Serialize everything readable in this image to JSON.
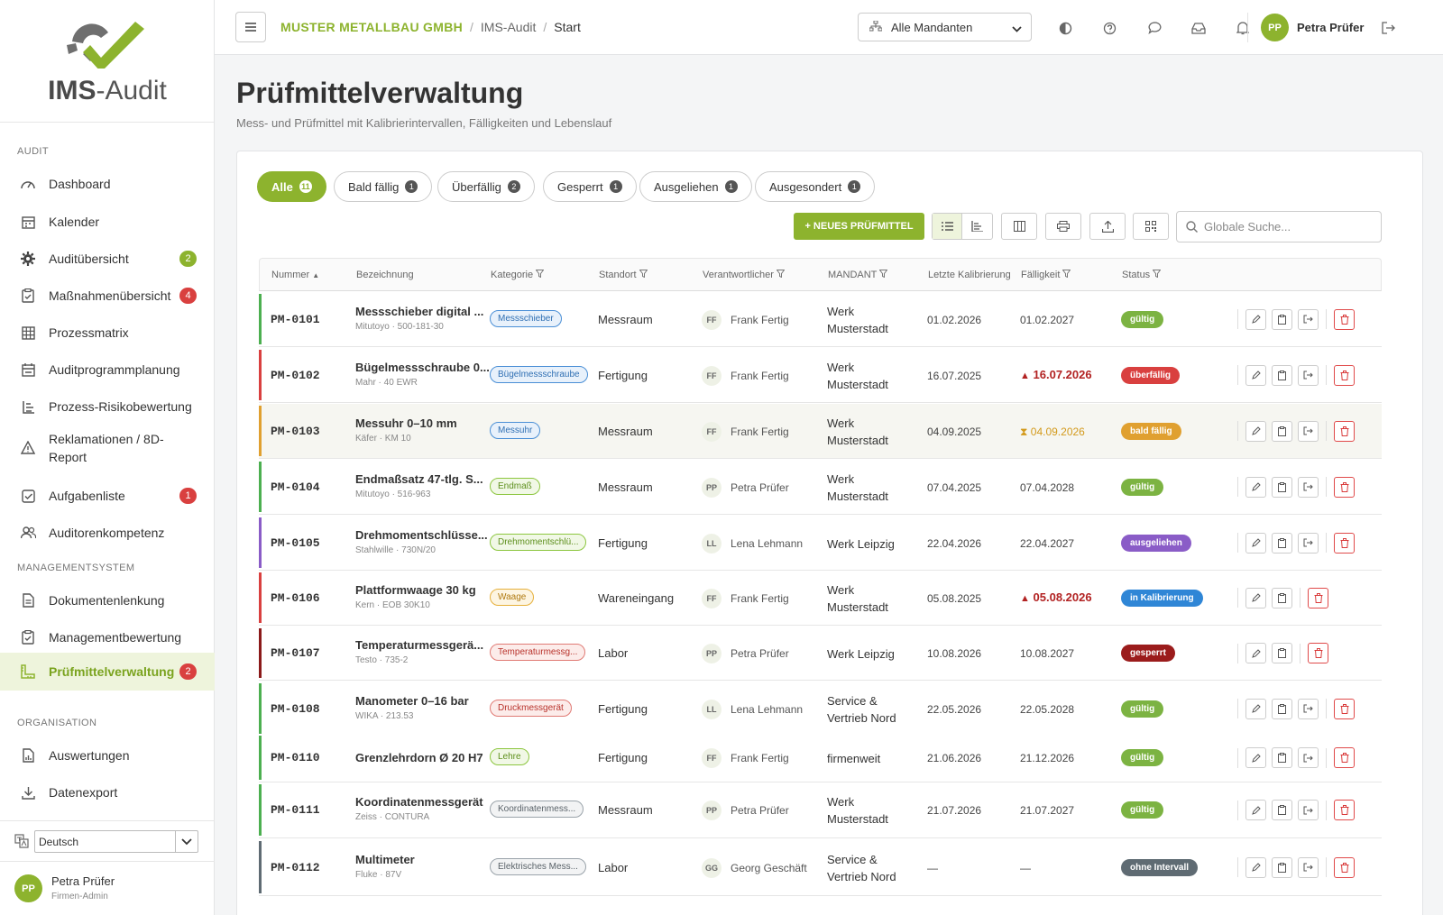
{
  "app": {
    "logo_text_bold": "IMS",
    "logo_text_rest": "-Audit"
  },
  "sidebar": {
    "sections": [
      "AUDIT",
      "MANAGEMENTSYSTEM",
      "ORGANISATION"
    ],
    "items": [
      {
        "label": "Dashboard",
        "icon": "dashboard-icon"
      },
      {
        "label": "Kalender",
        "icon": "calendar-icon"
      },
      {
        "label": "Auditübersicht",
        "icon": "gear-icon",
        "badge": "2",
        "badge_color": "#8db32e"
      },
      {
        "label": "Maßnahmenübersicht",
        "icon": "clipboard-check-icon",
        "badge": "4",
        "badge_color": "#d9403f"
      },
      {
        "label": "Prozessmatrix",
        "icon": "grid-icon"
      },
      {
        "label": "Auditprogrammplanung",
        "icon": "calendar-plan-icon"
      },
      {
        "label": "Prozess-Risikobewertung",
        "icon": "list-tree-icon"
      },
      {
        "label": "Reklamationen / 8D-",
        "label2": "Report",
        "icon": "warning-icon"
      },
      {
        "label": "Aufgabenliste",
        "icon": "checkbox-icon",
        "badge": "1",
        "badge_color": "#d9403f"
      },
      {
        "label": "Auditorenkompetenz",
        "icon": "users-icon"
      },
      {
        "label": "Dokumentenlenkung",
        "icon": "document-icon"
      },
      {
        "label": "Managementbewertung",
        "icon": "clipboard-icon"
      },
      {
        "label": "Prüfmittelverwaltung",
        "icon": "ruler-icon",
        "badge": "2",
        "badge_color": "#d9403f"
      },
      {
        "label": "Auswertungen",
        "icon": "chart-icon"
      },
      {
        "label": "Datenexport",
        "icon": "download-icon"
      }
    ],
    "language": "Deutsch",
    "user": {
      "initials": "PP",
      "name": "Petra Prüfer",
      "role": "Firmen-Admin"
    }
  },
  "topbar": {
    "breadcrumb": [
      "MUSTER METALLBAU GMBH",
      "IMS-Audit",
      "Start"
    ],
    "mandant_select": "Alle Mandanten",
    "user_initials": "PP",
    "user_name": "Petra Prüfer"
  },
  "page": {
    "title": "Prüfmittelverwaltung",
    "subtitle": "Mess- und Prüfmittel mit Kalibrierintervallen, Fälligkeiten und Lebenslauf"
  },
  "filters": [
    {
      "label": "Alle",
      "count": "11"
    },
    {
      "label": "Bald fällig",
      "count": "1"
    },
    {
      "label": "Überfällig",
      "count": "2"
    },
    {
      "label": "Gesperrt",
      "count": "1"
    },
    {
      "label": "Ausgeliehen",
      "count": "1"
    },
    {
      "label": "Ausgesondert",
      "count": "1"
    }
  ],
  "toolbar": {
    "new_button": "+ NEUES PRÜFMITTEL",
    "search_placeholder": "Globale Suche..."
  },
  "columns": [
    "Nummer",
    "Bezeichnung",
    "Kategorie",
    "Standort",
    "Verantwortlicher",
    "MANDANT",
    "Letzte Kalibrierung",
    "Fälligkeit",
    "Status"
  ],
  "colors": {
    "accent": "#8db32e",
    "danger": "#d9403f"
  },
  "rows": [
    {
      "nr": "PM-0101",
      "name": "Messschieber digital ...",
      "sub": "Mitutoyo · 500-181-30",
      "kat": "Messschieber",
      "kat_color": "blue",
      "ort": "Messraum",
      "init": "FF",
      "resp": "Frank Fertig",
      "mandant": "Werk Musterstadt",
      "last": "01.02.2026",
      "due": "01.02.2027",
      "due_type": "normal",
      "status": "gültig",
      "status_color": "#7cb342",
      "bar": "#4caf50"
    },
    {
      "nr": "PM-0102",
      "name": "Bügelmessschraube 0...",
      "sub": "Mahr · 40 EWR",
      "kat": "Bügelmessschraube",
      "kat_color": "blue",
      "ort": "Fertigung",
      "init": "FF",
      "resp": "Frank Fertig",
      "mandant": "Werk Musterstadt",
      "last": "16.07.2025",
      "due": "16.07.2026",
      "due_type": "red",
      "status": "überfällig",
      "status_color": "#d9403f",
      "bar": "#d9403f"
    },
    {
      "nr": "PM-0103",
      "name": "Messuhr 0–10 mm",
      "sub": "Käfer · KM 10",
      "kat": "Messuhr",
      "kat_color": "blue",
      "ort": "Messraum",
      "init": "FF",
      "resp": "Frank Fertig",
      "mandant": "Werk Musterstadt",
      "last": "04.09.2025",
      "due": "04.09.2026",
      "due_type": "orange",
      "status": "bald fällig",
      "status_color": "#e0a030",
      "bar": "#e0a030"
    },
    {
      "nr": "PM-0104",
      "name": "Endmaßsatz 47-tlg. S...",
      "sub": "Mitutoyo · 516-963",
      "kat": "Endmaß",
      "kat_color": "green",
      "ort": "Messraum",
      "init": "PP",
      "resp": "Petra Prüfer",
      "mandant": "Werk Musterstadt",
      "last": "07.04.2025",
      "due": "07.04.2028",
      "due_type": "normal",
      "status": "gültig",
      "status_color": "#7cb342",
      "bar": "#4caf50"
    },
    {
      "nr": "PM-0105",
      "name": "Drehmomentschlüsse...",
      "sub": "Stahlwille · 730N/20",
      "kat": "Drehmomentschlü...",
      "kat_color": "green",
      "ort": "Fertigung",
      "init": "LL",
      "resp": "Lena Lehmann",
      "mandant": "Werk Leipzig",
      "last": "22.04.2026",
      "due": "22.04.2027",
      "due_type": "normal",
      "status": "ausgeliehen",
      "status_color": "#8a5cc7",
      "bar": "#8a5cc7"
    },
    {
      "nr": "PM-0106",
      "name": "Plattformwaage 30 kg",
      "sub": "Kern · EOB 30K10",
      "kat": "Waage",
      "kat_color": "orange",
      "ort": "Wareneingang",
      "init": "FF",
      "resp": "Frank Fertig",
      "mandant": "Werk Musterstadt",
      "last": "05.08.2025",
      "due": "05.08.2026",
      "due_type": "red",
      "status": "in Kalibrierung",
      "status_color": "#2f86d6",
      "bar": "#d9403f"
    },
    {
      "nr": "PM-0107",
      "name": "Temperaturmessgerä...",
      "sub": "Testo · 735-2",
      "kat": "Temperaturmessg...",
      "kat_color": "red",
      "ort": "Labor",
      "init": "PP",
      "resp": "Petra Prüfer",
      "mandant": "Werk Leipzig",
      "last": "10.08.2026",
      "due": "10.08.2027",
      "due_type": "normal",
      "status": "gesperrt",
      "status_color": "#9b1c1c",
      "bar": "#8b1a1a"
    },
    {
      "nr": "PM-0108",
      "name": "Manometer 0–16 bar",
      "sub": "WIKA · 213.53",
      "kat": "Druckmessgerät",
      "kat_color": "red",
      "ort": "Fertigung",
      "init": "LL",
      "resp": "Lena Lehmann",
      "mandant": "Service & Vertrieb Nord",
      "last": "22.05.2026",
      "due": "22.05.2028",
      "due_type": "normal",
      "status": "gültig",
      "status_color": "#7cb342",
      "bar": "#4caf50"
    },
    {
      "nr": "PM-0110",
      "name": "Grenzlehrdorn Ø 20 H7",
      "sub": "",
      "kat": "Lehre",
      "kat_color": "green",
      "ort": "Fertigung",
      "init": "FF",
      "resp": "Frank Fertig",
      "mandant": "firmenweit",
      "last": "21.06.2026",
      "due": "21.12.2026",
      "due_type": "normal",
      "status": "gültig",
      "status_color": "#7cb342",
      "bar": "#4caf50"
    },
    {
      "nr": "PM-0111",
      "name": "Koordinatenmessgerät",
      "sub": "Zeiss · CONTURA",
      "kat": "Koordinatenmess...",
      "kat_color": "gray",
      "ort": "Messraum",
      "init": "PP",
      "resp": "Petra Prüfer",
      "mandant": "Werk Musterstadt",
      "last": "21.07.2026",
      "due": "21.07.2027",
      "due_type": "normal",
      "status": "gültig",
      "status_color": "#7cb342",
      "bar": "#4caf50"
    },
    {
      "nr": "PM-0112",
      "name": "Multimeter",
      "sub": "Fluke · 87V",
      "kat": "Elektrisches Mess...",
      "kat_color": "gray",
      "ort": "Labor",
      "init": "GG",
      "resp": "Georg Geschäft",
      "mandant": "Service & Vertrieb Nord",
      "last": "—",
      "due": "—",
      "due_type": "normal",
      "status": "ohne Intervall",
      "status_color": "#5f6b73",
      "bar": "#5f6b73"
    }
  ]
}
